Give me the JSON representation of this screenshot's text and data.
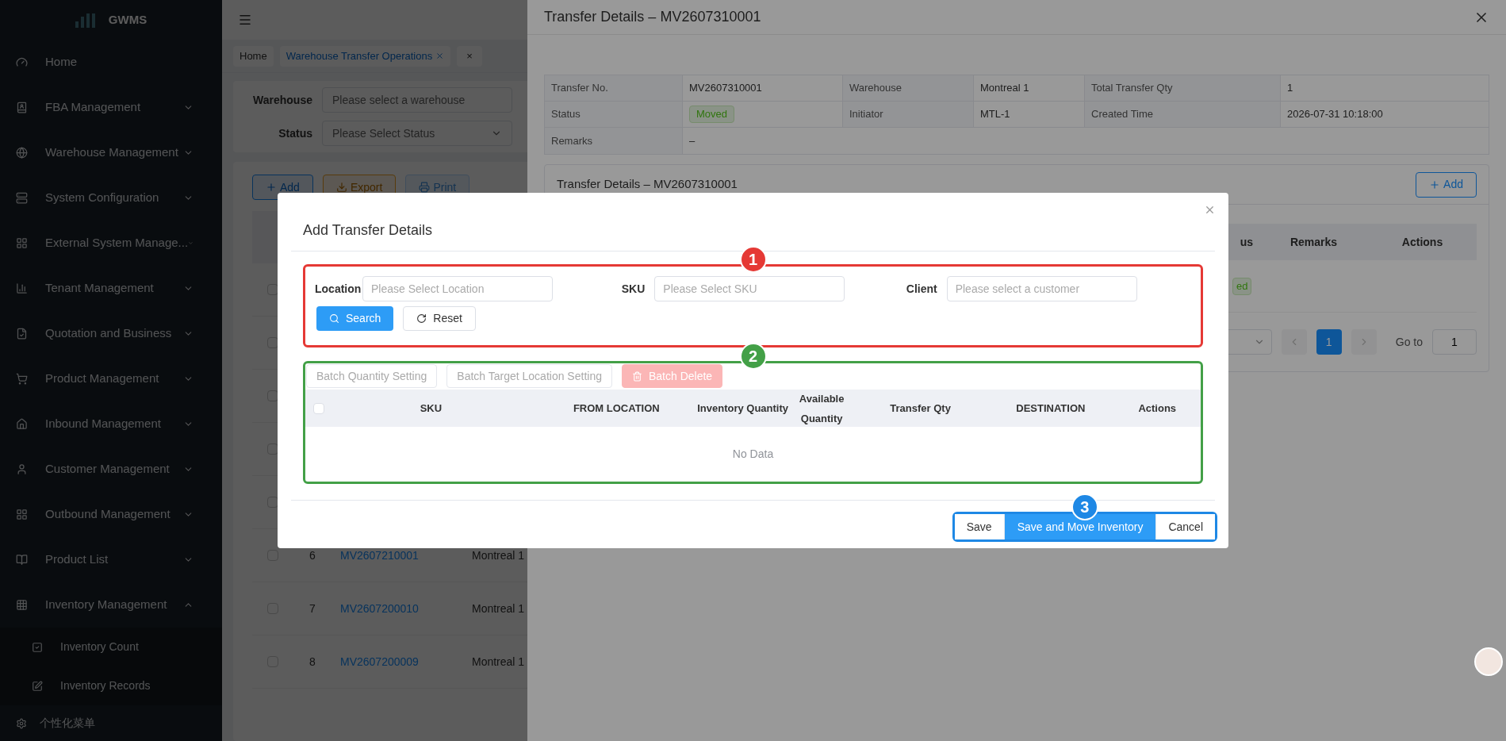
{
  "sidebar": {
    "logo": "GWMS",
    "items": [
      {
        "label": "Home",
        "kind": "link"
      },
      {
        "label": "FBA Management",
        "kind": "submenu",
        "expanded": false
      },
      {
        "label": "Warehouse Management",
        "kind": "submenu",
        "expanded": false
      },
      {
        "label": "System Configuration",
        "kind": "submenu",
        "expanded": false
      },
      {
        "label": "External System Manage...",
        "kind": "submenu",
        "expanded": false
      },
      {
        "label": "Tenant Management",
        "kind": "submenu",
        "expanded": false
      },
      {
        "label": "Quotation and Business",
        "kind": "submenu",
        "expanded": false
      },
      {
        "label": "Product Management",
        "kind": "submenu",
        "expanded": false
      },
      {
        "label": "Inbound Management",
        "kind": "submenu",
        "expanded": false
      },
      {
        "label": "Customer Management",
        "kind": "submenu",
        "expanded": false
      },
      {
        "label": "Outbound Management",
        "kind": "submenu",
        "expanded": false
      },
      {
        "label": "Product List",
        "kind": "submenu",
        "expanded": false
      },
      {
        "label": "Inventory Management",
        "kind": "submenu",
        "expanded": true,
        "children": [
          {
            "label": "Inventory Count"
          },
          {
            "label": "Inventory Records"
          }
        ]
      }
    ],
    "footer": "个性化菜单"
  },
  "tabs": [
    {
      "label": "Home",
      "selected": false,
      "closable": false
    },
    {
      "label": "Warehouse Transfer Operations",
      "selected": true,
      "closable": true
    }
  ],
  "tab_close_all": "×",
  "filters": [
    {
      "label": "Warehouse",
      "placeholder": "Please select a warehouse",
      "kind": "input"
    },
    {
      "label": "Status",
      "placeholder": "Please Select Status",
      "kind": "select"
    }
  ],
  "toolbar": [
    {
      "label": "Add",
      "kind": "add"
    },
    {
      "label": "Export",
      "kind": "export"
    },
    {
      "label": "Print",
      "kind": "print"
    }
  ],
  "rows": [
    {
      "checked": false
    },
    {
      "checked": false
    },
    {
      "checked": false
    },
    {
      "checked": false
    },
    {
      "checked": false
    },
    {
      "checked": false,
      "index": "6",
      "transfer_no": "MV2607210001",
      "warehouse": "Montreal 1"
    },
    {
      "checked": false,
      "index": "7",
      "transfer_no": "MV2607200010",
      "warehouse": "Montreal 1"
    },
    {
      "checked": false,
      "index": "8",
      "transfer_no": "MV2607200009",
      "warehouse": "Montreal 1"
    }
  ],
  "drawer": {
    "title": "Transfer Details – MV2607310001",
    "descriptions": [
      [
        {
          "label": "Transfer No.",
          "value": "MV2607310001"
        },
        {
          "label": "Warehouse",
          "value": "Montreal 1"
        },
        {
          "label": "Total Transfer Qty",
          "value": "1"
        }
      ],
      [
        {
          "label": "Status",
          "value": "Moved",
          "kind": "tag"
        },
        {
          "label": "Initiator",
          "value": "MTL-1"
        },
        {
          "label": "Created Time",
          "value": "2026-07-31 10:18:00"
        }
      ],
      [
        {
          "label": "Remarks",
          "value": "–"
        }
      ]
    ],
    "card_title": "Transfer Details – MV2607310001",
    "add_button": "Add",
    "columns": [
      "us",
      "Remarks",
      "Actions"
    ],
    "row_tag": "ed",
    "pagination": {
      "current": "1",
      "goto_label": "Go to",
      "goto_value": "1"
    }
  },
  "modal": {
    "title": "Add Transfer Details",
    "search_section": {
      "number": "1",
      "color": "#e53935",
      "fields": [
        {
          "label": "Location",
          "placeholder": "Please Select Location"
        },
        {
          "label": "SKU",
          "placeholder": "Please Select SKU"
        },
        {
          "label": "Client",
          "placeholder": "Please select a customer"
        }
      ],
      "search_button": "Search",
      "reset_button": "Reset"
    },
    "table_section": {
      "number": "2",
      "color": "#43a047",
      "actions": [
        {
          "label": "Batch Quantity Setting",
          "disabled": true,
          "kind": "plain"
        },
        {
          "label": "Batch Target Location Setting",
          "disabled": true,
          "kind": "plain"
        },
        {
          "label": "Batch Delete",
          "disabled": true,
          "kind": "danger"
        }
      ],
      "columns": [
        "SKU",
        "FROM LOCATION",
        "Inventory Quantity",
        "Available Quantity",
        "Transfer Qty",
        "DESTINATION",
        "Actions"
      ],
      "empty": "No Data"
    },
    "footer_section": {
      "number": "3",
      "color": "#1e88e5",
      "buttons": [
        {
          "label": "Save",
          "primary": false
        },
        {
          "label": "Save and Move Inventory",
          "primary": true
        },
        {
          "label": "Cancel",
          "primary": false
        }
      ]
    }
  }
}
